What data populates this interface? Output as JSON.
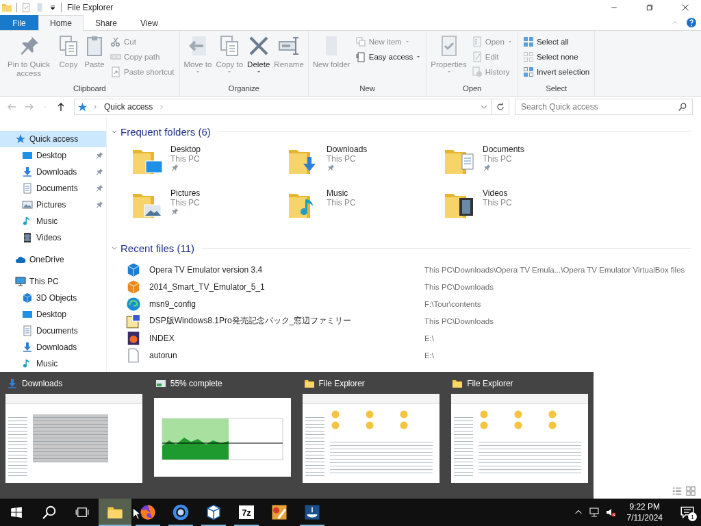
{
  "window": {
    "title": "File Explorer"
  },
  "ribbon_tabs": [
    {
      "label": "File",
      "kind": "application-menu",
      "selected": false
    },
    {
      "label": "Home",
      "kind": "tab",
      "selected": true
    },
    {
      "label": "Share",
      "kind": "tab",
      "selected": false
    },
    {
      "label": "View",
      "kind": "tab",
      "selected": false
    }
  ],
  "ribbon_groups": [
    {
      "name": "Clipboard",
      "columns": [
        {
          "kind": "large",
          "label": "Pin to Quick access",
          "disabled": true,
          "dropdown": false
        },
        {
          "kind": "large",
          "label": "Copy",
          "disabled": true,
          "dropdown": false
        },
        {
          "kind": "large",
          "label": "Paste",
          "disabled": true,
          "dropdown": false
        },
        {
          "kind": "stack",
          "buttons": [
            {
              "label": "Cut",
              "disabled": true,
              "dropdown": false
            },
            {
              "label": "Copy path",
              "disabled": true,
              "dropdown": false
            },
            {
              "label": "Paste shortcut",
              "disabled": true,
              "dropdown": false
            }
          ]
        }
      ]
    },
    {
      "name": "Organize",
      "columns": [
        {
          "kind": "large",
          "label": "Move to",
          "disabled": true,
          "dropdown": true
        },
        {
          "kind": "large",
          "label": "Copy to",
          "disabled": true,
          "dropdown": true
        },
        {
          "kind": "large",
          "label": "Delete",
          "disabled": false,
          "dropdown": true
        },
        {
          "kind": "large",
          "label": "Rename",
          "disabled": true,
          "dropdown": false
        }
      ]
    },
    {
      "name": "New",
      "columns": [
        {
          "kind": "large",
          "label": "New folder",
          "disabled": true,
          "dropdown": false
        },
        {
          "kind": "stack",
          "buttons": [
            {
              "label": "New item",
              "disabled": true,
              "dropdown": true
            },
            {
              "label": "Easy access",
              "disabled": false,
              "dropdown": true
            }
          ]
        }
      ]
    },
    {
      "name": "Open",
      "columns": [
        {
          "kind": "large",
          "label": "Properties",
          "disabled": true,
          "dropdown": true
        },
        {
          "kind": "stack",
          "buttons": [
            {
              "label": "Open",
              "disabled": true,
              "dropdown": true
            },
            {
              "label": "Edit",
              "disabled": true,
              "dropdown": false
            },
            {
              "label": "History",
              "disabled": true,
              "dropdown": false
            }
          ]
        }
      ]
    },
    {
      "name": "Select",
      "columns": [
        {
          "kind": "stack",
          "buttons": [
            {
              "label": "Select all",
              "disabled": false,
              "dropdown": false
            },
            {
              "label": "Select none",
              "disabled": false,
              "dropdown": false
            },
            {
              "label": "Invert selection",
              "disabled": false,
              "dropdown": false
            }
          ]
        }
      ]
    }
  ],
  "navigation_buttons": [
    {
      "kind": "back",
      "disabled": true
    },
    {
      "kind": "forward",
      "disabled": true
    },
    {
      "kind": "recent",
      "disabled": true
    },
    {
      "kind": "up",
      "disabled": false
    }
  ],
  "address_bar": {
    "path": [
      "Quick access"
    ]
  },
  "search": {
    "placeholder": "Search Quick access"
  },
  "navigation_pane": [
    {
      "label": "Quick access",
      "kind": "star",
      "selected": true,
      "children": [
        {
          "label": "Desktop",
          "kind": "desktop",
          "selected": false,
          "pinned": true
        },
        {
          "label": "Downloads",
          "kind": "download",
          "selected": false,
          "pinned": true
        },
        {
          "label": "Documents",
          "kind": "document",
          "selected": false,
          "pinned": true
        },
        {
          "label": "Pictures",
          "kind": "picture",
          "selected": false,
          "pinned": true
        },
        {
          "label": "Music",
          "kind": "music",
          "selected": false,
          "pinned": false
        },
        {
          "label": "Videos",
          "kind": "video",
          "selected": false,
          "pinned": false
        }
      ]
    },
    {
      "label": "OneDrive",
      "kind": "cloud",
      "selected": false
    },
    {
      "label": "This PC",
      "kind": "computer",
      "selected": false,
      "children": [
        {
          "label": "3D Objects",
          "kind": "cube",
          "selected": false
        },
        {
          "label": "Desktop",
          "kind": "desktop",
          "selected": false
        },
        {
          "label": "Documents",
          "kind": "document",
          "selected": false
        },
        {
          "label": "Downloads",
          "kind": "download",
          "selected": false
        },
        {
          "label": "Music",
          "kind": "music",
          "selected": false
        }
      ]
    }
  ],
  "frequent_folders": {
    "title": "Frequent folders (6)",
    "expanded": true,
    "items": [
      {
        "name": "Desktop",
        "location": "This PC",
        "kind": "desktop",
        "pinned": true
      },
      {
        "name": "Downloads",
        "location": "This PC",
        "kind": "download",
        "pinned": true
      },
      {
        "name": "Documents",
        "location": "This PC",
        "kind": "document",
        "pinned": true
      },
      {
        "name": "Pictures",
        "location": "This PC",
        "kind": "picture",
        "pinned": true
      },
      {
        "name": "Music",
        "location": "This PC",
        "kind": "music",
        "pinned": false
      },
      {
        "name": "Videos",
        "location": "This PC",
        "kind": "video",
        "pinned": false
      }
    ]
  },
  "recent_files": {
    "title": "Recent files (11)",
    "expanded": true,
    "items": [
      {
        "name": "Opera TV Emulator version 3.4",
        "location": "This PC\\Downloads\\Opera TV Emula...\\Opera TV Emulator VirtualBox files",
        "kind": "cube"
      },
      {
        "name": "2014_Smart_TV_Emulator_5_1",
        "location": "This PC\\Downloads",
        "kind": "box"
      },
      {
        "name": "msn9_config",
        "location": "F:\\Tour\\contents",
        "kind": "swirl"
      },
      {
        "name": "DSP版Windows8.1Pro発売記念パック_窓辺ファミリー",
        "location": "This PC\\Downloads",
        "kind": "disc-image"
      },
      {
        "name": "INDEX",
        "location": "E:\\",
        "kind": "web-page"
      },
      {
        "name": "autorun",
        "location": "E:\\",
        "kind": "file"
      }
    ]
  },
  "task_switcher": [
    {
      "title": "Downloads",
      "kind": "downloads"
    },
    {
      "title": "55% complete",
      "kind": "progress"
    },
    {
      "title": "File Explorer",
      "kind": "explorer"
    },
    {
      "title": "File Explorer",
      "kind": "explorer"
    }
  ],
  "taskbar": {
    "apps": [
      {
        "kind": "folder",
        "active": true,
        "running": true
      },
      {
        "kind": "fox",
        "active": false,
        "running": true
      },
      {
        "kind": "ring",
        "active": false,
        "running": true
      },
      {
        "kind": "cube-outline",
        "active": false,
        "running": true
      },
      {
        "kind": "archiver",
        "label": "7z",
        "active": false,
        "running": true
      },
      {
        "kind": "paint",
        "active": false,
        "running": false
      },
      {
        "kind": "dish",
        "active": false,
        "running": true
      }
    ],
    "time": "9:22 PM",
    "date": "7/11/2024",
    "notifications": "1"
  }
}
